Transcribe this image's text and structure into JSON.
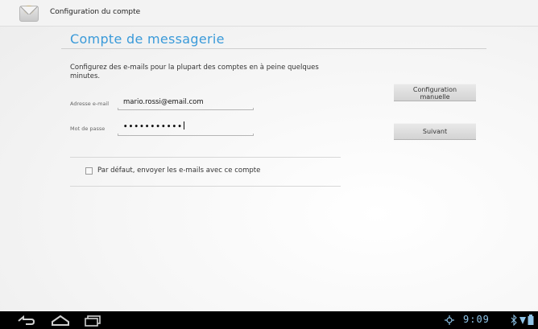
{
  "header": {
    "app_title": "Configuration du compte",
    "icon": "mail-envelope-icon"
  },
  "main": {
    "title": "Compte de messagerie",
    "description": "Configurez des e-mails pour la plupart des comptes en à peine quelques minutes.",
    "email": {
      "label": "Adresse e-mail",
      "value": "mario.rossi@email.com"
    },
    "password": {
      "label": "Mot de passe",
      "masked_value": "•••••••••••"
    },
    "manual_button": {
      "line1": "Configuration",
      "line2": "manuelle"
    },
    "next_button": "Suivant",
    "default_checkbox": {
      "label": "Par défaut, envoyer les e-mails avec ce compte",
      "checked": false
    }
  },
  "navbar": {
    "back": "back-icon",
    "home": "home-icon",
    "recents": "recent-apps-icon",
    "time": "9:09",
    "accent": "#8fc4e8"
  }
}
